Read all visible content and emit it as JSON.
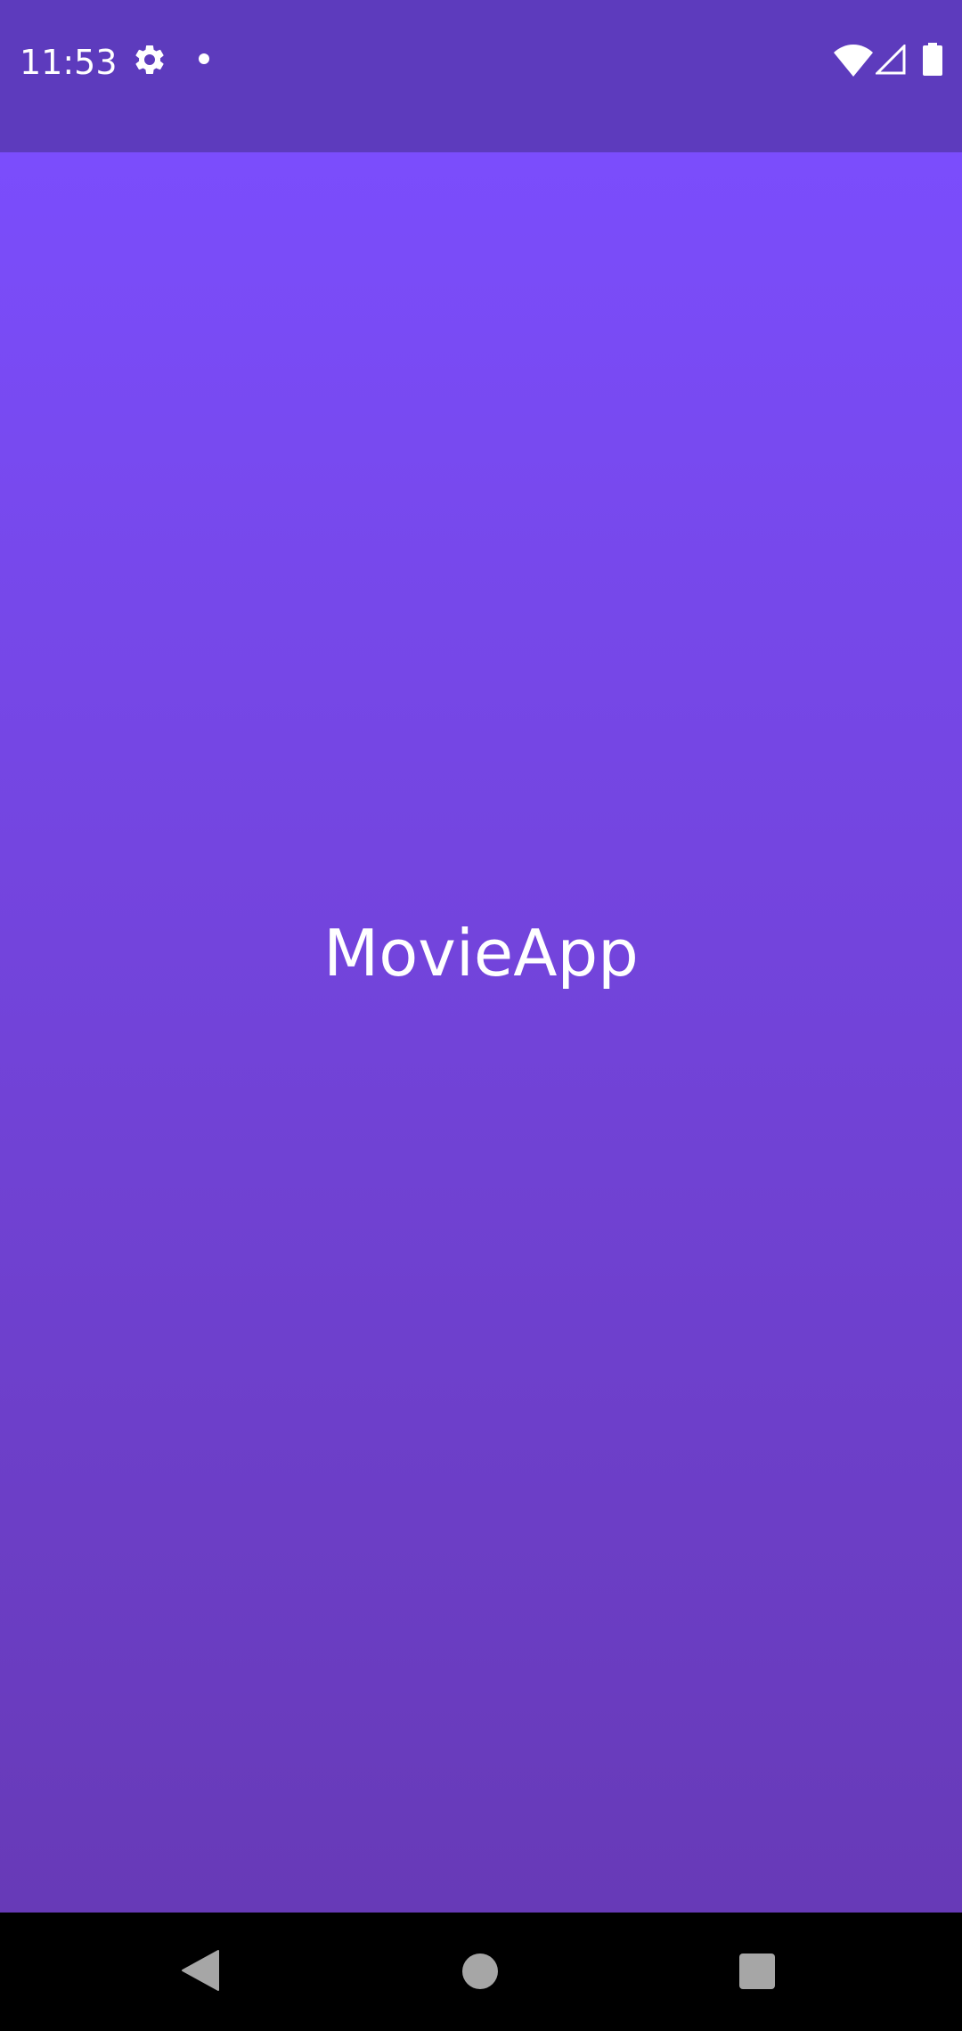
{
  "status_bar": {
    "time": "11:53",
    "icons": [
      "gear-icon",
      "notification-dot-icon",
      "wifi-icon",
      "cell-signal-icon",
      "battery-icon"
    ]
  },
  "splash": {
    "title": "MovieApp",
    "colors": {
      "status_bar": "#5d3bbd",
      "gradient_top": "#7b4dfc",
      "gradient_bottom": "#673ab7",
      "text": "#ffffff"
    }
  },
  "navigation_bar": {
    "buttons": [
      "back-icon",
      "home-icon",
      "recents-icon"
    ]
  }
}
